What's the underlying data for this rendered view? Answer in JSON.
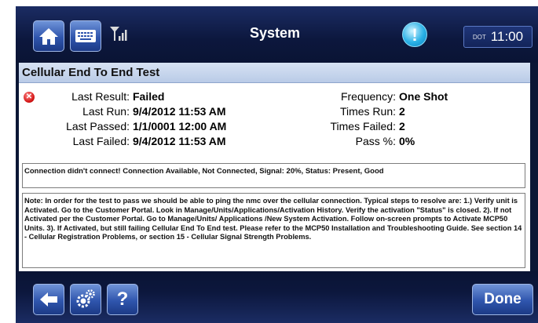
{
  "header": {
    "title": "System",
    "clock_prefix": "DOT",
    "clock_time": "11:00",
    "alert_glyph": "!"
  },
  "test": {
    "name": "Cellular End To End  Test",
    "left_fields": [
      {
        "label": "Last Result:",
        "value": "Failed"
      },
      {
        "label": "Last Run:",
        "value": "9/4/2012 11:53 AM"
      },
      {
        "label": "Last Passed:",
        "value": "1/1/0001 12:00 AM"
      },
      {
        "label": "Last Failed:",
        "value": "9/4/2012 11:53 AM"
      }
    ],
    "right_fields": [
      {
        "label": "Frequency:",
        "value": "One Shot"
      },
      {
        "label": "Times Run:",
        "value": "2"
      },
      {
        "label": "Times Failed:",
        "value": "2"
      },
      {
        "label": "Pass %:",
        "value": "0%"
      }
    ],
    "message": "Connection didn't connect! Connection Available, Not Connected, Signal: 20%, Status: Present, Good",
    "note": "Note: In order for the test to pass we should be able to ping the nmc over the cellular connection. Typical steps to resolve are: 1.) Verify unit is Activated.  Go to the Customer Portal.  Look in Manage/Units/Applications/Activation History.  Verify the activation \"Status\" is closed. 2). If not Activated per the Customer Portal.  Go to Manage/Units/ Applications /New System Activation. Follow on-screen prompts to Activate MCP50 Units. 3). If Activated, but still failing Cellular End To End test. Please refer to the MCP50 Installation and Troubleshooting Guide.  See  section 14 - Cellular Registration Problems, or section 15 - Cellular Signal Strength Problems."
  },
  "footer": {
    "help_label": "?",
    "done_label": "Done"
  },
  "icons": {
    "home": "home-icon",
    "keyboard": "keyboard-icon",
    "signal": "signal-strength-icon",
    "alert": "alert-icon",
    "error": "error-icon",
    "back": "back-arrow-icon",
    "settings": "gears-icon"
  },
  "colors": {
    "frame": "#0b1635",
    "button": "#2f55ad",
    "alert": "#2ab1e6",
    "error": "#d41414",
    "header_band": "#c7d6ee"
  }
}
